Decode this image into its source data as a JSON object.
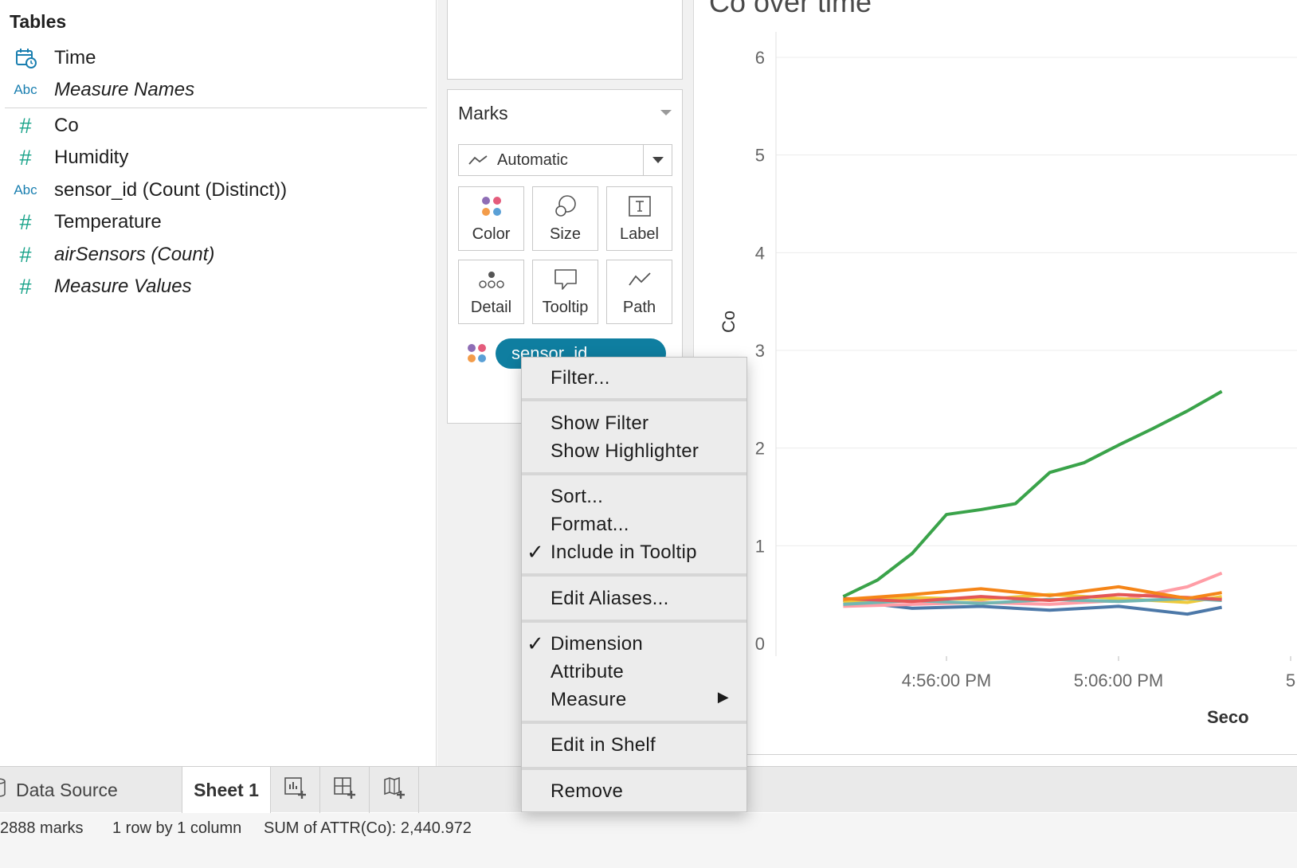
{
  "data_pane": {
    "title": "Tables",
    "fields": [
      {
        "icon": "calendar-clock-icon",
        "type": "",
        "label": "Time",
        "italic": false
      },
      {
        "icon": "abc-icon",
        "type": "Abc",
        "label": "Measure Names",
        "italic": true
      },
      {
        "icon": "hash-icon",
        "type": "#",
        "label": "Co",
        "italic": false
      },
      {
        "icon": "hash-icon",
        "type": "#",
        "label": "Humidity",
        "italic": false
      },
      {
        "icon": "abc-icon",
        "type": "Abc",
        "label": "sensor_id (Count (Distinct))",
        "italic": false
      },
      {
        "icon": "hash-icon",
        "type": "#",
        "label": "Temperature",
        "italic": false
      },
      {
        "icon": "hash-icon",
        "type": "#",
        "label": "airSensors (Count)",
        "italic": true
      },
      {
        "icon": "hash-icon",
        "type": "#",
        "label": "Measure Values",
        "italic": true
      }
    ]
  },
  "marks_card": {
    "title": "Marks",
    "mark_type": "Automatic",
    "buttons": {
      "color": "Color",
      "size": "Size",
      "label": "Label",
      "detail": "Detail",
      "tooltip": "Tooltip",
      "path": "Path"
    },
    "pill": "sensor_id"
  },
  "viz": {
    "title": "Co over time",
    "y_axis_label": "Co",
    "x_axis_label": "Seco",
    "x_ticks": [
      "4:56:00 PM",
      "5:06:00 PM",
      "5"
    ]
  },
  "chart_data": {
    "type": "line",
    "title": "Co over time",
    "ylabel": "Co",
    "xlabel": "Seco",
    "ylim": [
      0,
      6
    ],
    "y_ticks": [
      0,
      1,
      2,
      3,
      4,
      5,
      6
    ],
    "x_tick_labels": [
      "4:56:00 PM",
      "5:06:00 PM",
      "5"
    ],
    "grid": true,
    "series": [
      {
        "color": "#3aa34a",
        "x": [
          "4:50:00 PM",
          "4:52:00 PM",
          "4:54:00 PM",
          "4:56:00 PM",
          "4:58:00 PM",
          "5:00:00 PM",
          "5:02:00 PM",
          "5:04:00 PM",
          "5:06:00 PM",
          "5:08:00 PM",
          "5:10:00 PM",
          "5:12:00 PM"
        ],
        "values": [
          0.48,
          0.65,
          0.92,
          1.32,
          1.37,
          1.43,
          1.75,
          1.85,
          2.03,
          2.2,
          2.38,
          2.58
        ]
      },
      {
        "color": "#f58518",
        "x": [
          "4:50:00 PM",
          "4:54:00 PM",
          "4:58:00 PM",
          "5:02:00 PM",
          "5:06:00 PM",
          "5:10:00 PM",
          "5:12:00 PM"
        ],
        "values": [
          0.45,
          0.5,
          0.56,
          0.49,
          0.58,
          0.46,
          0.52
        ]
      },
      {
        "color": "#e45756",
        "x": [
          "4:50:00 PM",
          "4:54:00 PM",
          "4:58:00 PM",
          "5:02:00 PM",
          "5:06:00 PM",
          "5:10:00 PM",
          "5:12:00 PM"
        ],
        "values": [
          0.46,
          0.43,
          0.48,
          0.44,
          0.5,
          0.47,
          0.45
        ]
      },
      {
        "color": "#72b7b2",
        "x": [
          "4:50:00 PM",
          "4:54:00 PM",
          "4:58:00 PM",
          "5:02:00 PM",
          "5:06:00 PM",
          "5:10:00 PM",
          "5:12:00 PM"
        ],
        "values": [
          0.4,
          0.44,
          0.41,
          0.45,
          0.43,
          0.46,
          0.44
        ]
      },
      {
        "color": "#eeca3b",
        "x": [
          "4:50:00 PM",
          "4:54:00 PM",
          "4:58:00 PM",
          "5:02:00 PM",
          "5:06:00 PM",
          "5:10:00 PM",
          "5:12:00 PM"
        ],
        "values": [
          0.43,
          0.47,
          0.45,
          0.5,
          0.46,
          0.42,
          0.48
        ]
      },
      {
        "color": "#ff9da6",
        "x": [
          "4:50:00 PM",
          "4:54:00 PM",
          "4:58:00 PM",
          "5:02:00 PM",
          "5:06:00 PM",
          "5:10:00 PM",
          "5:12:00 PM"
        ],
        "values": [
          0.38,
          0.4,
          0.42,
          0.4,
          0.44,
          0.58,
          0.72
        ]
      },
      {
        "color": "#4c78a8",
        "x": [
          "4:50:00 PM",
          "4:54:00 PM",
          "4:58:00 PM",
          "5:02:00 PM",
          "5:06:00 PM",
          "5:10:00 PM",
          "5:12:00 PM"
        ],
        "values": [
          0.44,
          0.36,
          0.38,
          0.34,
          0.38,
          0.3,
          0.37
        ]
      }
    ]
  },
  "context_menu": {
    "items": {
      "filter": "Filter...",
      "show_filter": "Show Filter",
      "show_highlighter": "Show Highlighter",
      "sort": "Sort...",
      "format": "Format...",
      "include_in_tooltip": "Include in Tooltip",
      "edit_aliases": "Edit Aliases...",
      "dimension": "Dimension",
      "attribute": "Attribute",
      "measure": "Measure",
      "edit_in_shelf": "Edit in Shelf",
      "remove": "Remove"
    },
    "checked": [
      "include_in_tooltip",
      "dimension"
    ],
    "check_glyph": "✓",
    "submenu_arrow": "▶"
  },
  "tabs": {
    "data_source": "Data Source",
    "sheet1": "Sheet 1"
  },
  "status": {
    "marks": "2888 marks",
    "rows_cols": "1 row by 1 column",
    "sum": "SUM of ATTR(Co): 2,440.972"
  }
}
